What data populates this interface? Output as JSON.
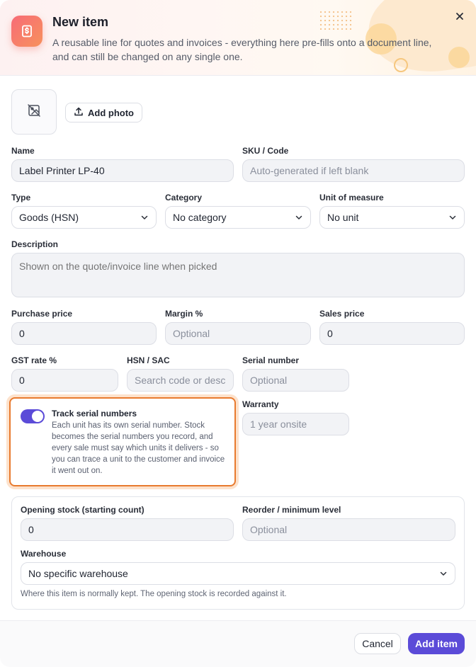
{
  "header": {
    "title": "New item",
    "subtitle": "A reusable line for quotes and invoices - everything here pre-fills onto a document line, and can still be changed on any single one."
  },
  "photo": {
    "add_label": "Add photo"
  },
  "fields": {
    "name": {
      "label": "Name",
      "value": "Label Printer LP-40"
    },
    "sku": {
      "label": "SKU / Code",
      "placeholder": "Auto-generated if left blank"
    },
    "type": {
      "label": "Type",
      "value": "Goods (HSN)"
    },
    "category": {
      "label": "Category",
      "value": "No category"
    },
    "unit": {
      "label": "Unit of measure",
      "value": "No unit"
    },
    "description": {
      "label": "Description",
      "placeholder": "Shown on the quote/invoice line when picked"
    },
    "purchase_price": {
      "label": "Purchase price",
      "value": "0"
    },
    "margin": {
      "label": "Margin %",
      "placeholder": "Optional"
    },
    "sales_price": {
      "label": "Sales price",
      "value": "0"
    },
    "gst_rate": {
      "label": "GST rate %",
      "value": "0"
    },
    "hsn_sac": {
      "label": "HSN / SAC",
      "placeholder": "Search code or desc"
    },
    "serial_number": {
      "label": "Serial number",
      "placeholder": "Optional"
    },
    "warranty": {
      "label": "Warranty",
      "placeholder": "1 year onsite"
    }
  },
  "serial_tracking": {
    "enabled": true,
    "title": "Track serial numbers",
    "description": "Each unit has its own serial number. Stock becomes the serial numbers you record, and every sale must say which units it delivers - so you can trace a unit to the customer and invoice it went out on."
  },
  "stock": {
    "opening": {
      "label": "Opening stock (starting count)",
      "value": "0"
    },
    "reorder": {
      "label": "Reorder / minimum level",
      "placeholder": "Optional"
    },
    "warehouse": {
      "label": "Warehouse",
      "value": "No specific warehouse"
    },
    "hint": "Where this item is normally kept. The opening stock is recorded against it."
  },
  "footer": {
    "cancel_label": "Cancel",
    "add_label": "Add item"
  },
  "colors": {
    "accent": "#5b4bd8",
    "highlight_border": "#e87a2e",
    "icon_gradient_start": "#f76b77",
    "icon_gradient_end": "#f7915c"
  },
  "icons": {
    "app": "invoice-dollar-icon",
    "close": "close-icon",
    "photo": "image-off-icon",
    "upload": "upload-icon",
    "chevron": "chevron-down-icon"
  }
}
